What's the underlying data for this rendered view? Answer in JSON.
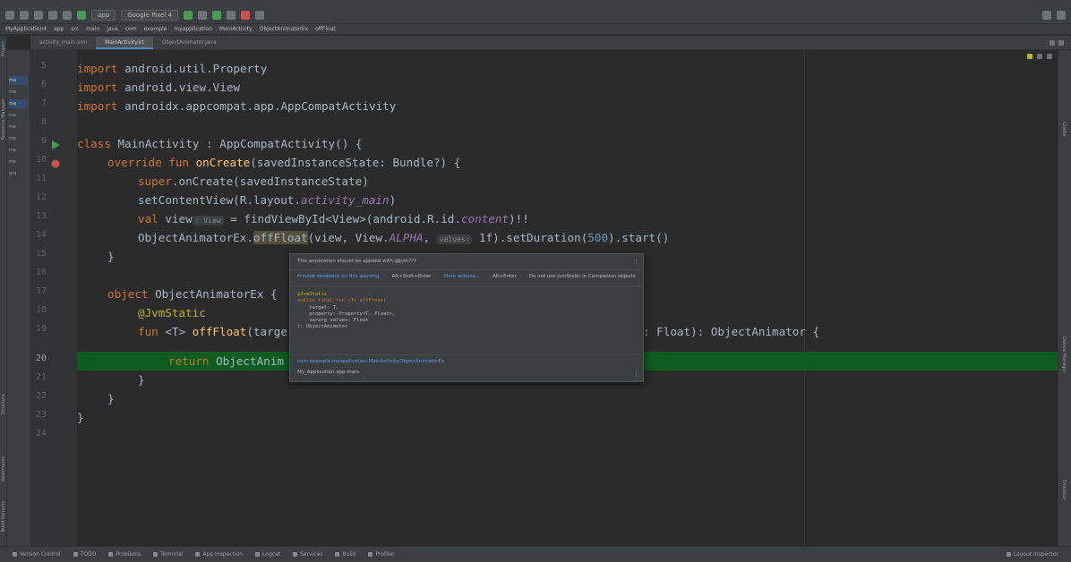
{
  "toolbar": {
    "module_combo": "app",
    "device_combo": "Google Pixel 4"
  },
  "navbar": {
    "crumbs": [
      "MyApplication4",
      "app",
      "src",
      "main",
      "java",
      "com",
      "example",
      "myapplication",
      "MainActivity",
      "ObjectAnimatorEx",
      "offFloat"
    ]
  },
  "tabs": [
    "activity_main.xml",
    "MainActivity.kt",
    "ObjectAnimator.java"
  ],
  "project": {
    "rows": [
      "",
      "",
      "ma",
      "ma",
      "ma",
      "ma",
      "ma",
      "ma",
      "ma",
      "ma",
      "gra"
    ]
  },
  "gutter": {
    "line_numbers": [
      "5",
      "6",
      "7",
      "8",
      "9",
      "10",
      "11",
      "12",
      "13",
      "14",
      "15",
      "16",
      "17",
      "18",
      "19",
      "20",
      "21",
      "22",
      "23",
      "24"
    ]
  },
  "code": {
    "l5_kw": "import",
    "l5_rest": " android.util.Property",
    "l6_kw": "import",
    "l6_rest": " android.view.View",
    "l7_kw": "import",
    "l7_rest": " androidx.appcompat.app.AppCompatActivity",
    "l9_kw": "class",
    "l9_rest": " MainActivity : AppCompatActivity() {",
    "l10_kw": "override fun",
    "l10_fn": " onCreate",
    "l10_rest": "(savedInstanceState: Bundle?) {",
    "l11_kw": "super",
    "l11_rest": ".onCreate(savedInstanceState)",
    "l12_a": "setContentView(R.layout.",
    "l12_b": "activity_main",
    "l12_c": ")",
    "l13_kw": "val",
    "l13_a": " view",
    "l13_hint": ": View",
    "l13_b": " = findViewById<View>(android.R.id.",
    "l13_c": "content",
    "l13_d": ")!!",
    "l14_a": "ObjectAnimatorEx.",
    "l14_b": "offFloat",
    "l14_c": "(view, View.",
    "l14_d": "ALPHA",
    "l14_e": ", ",
    "l14_hint": "values:",
    "l14_f": " 1f).setDuration(",
    "l14_g": "500",
    "l14_h": ").start()",
    "l15": "}",
    "l17_kw": "object",
    "l17_rest": " ObjectAnimatorEx {",
    "l18": "@JvmStatic",
    "l19_kw": "fun",
    "l19_a": " <T> ",
    "l19_fn": "offFloat",
    "l19_b": "(targe",
    "l19_tail": ": Float): ObjectAnimator {",
    "l20_kw": "return",
    "l20_rest": " ObjectAnim",
    "l21": "}",
    "l22": "}",
    "l23": "}"
  },
  "popup": {
    "title": "This annotation should be applied with @Jvm???",
    "actions": [
      "Provide feedback on this warning",
      "Alt+Shift+Enter",
      "More actions...",
      "Alt+Enter"
    ],
    "actions_tail": "Do not use JvmStatic in Companion objects",
    "body_lines": [
      "@JvmStatic",
      "public final fun <T> offFloat(",
      "    target: T,",
      "    property: Property<T, Float>,",
      "    vararg values: Float",
      "): ObjectAnimator"
    ],
    "link": "com.example.myapplication.MainActivity.ObjectAnimatorEx",
    "module": "My_Application.app.main"
  },
  "status": {
    "items": [
      "Version Control",
      "TODO",
      "Problems",
      "Terminal",
      "App Inspection",
      "Logcat",
      "Services",
      "Build",
      "Profiler"
    ],
    "right": "Layout Inspector"
  }
}
